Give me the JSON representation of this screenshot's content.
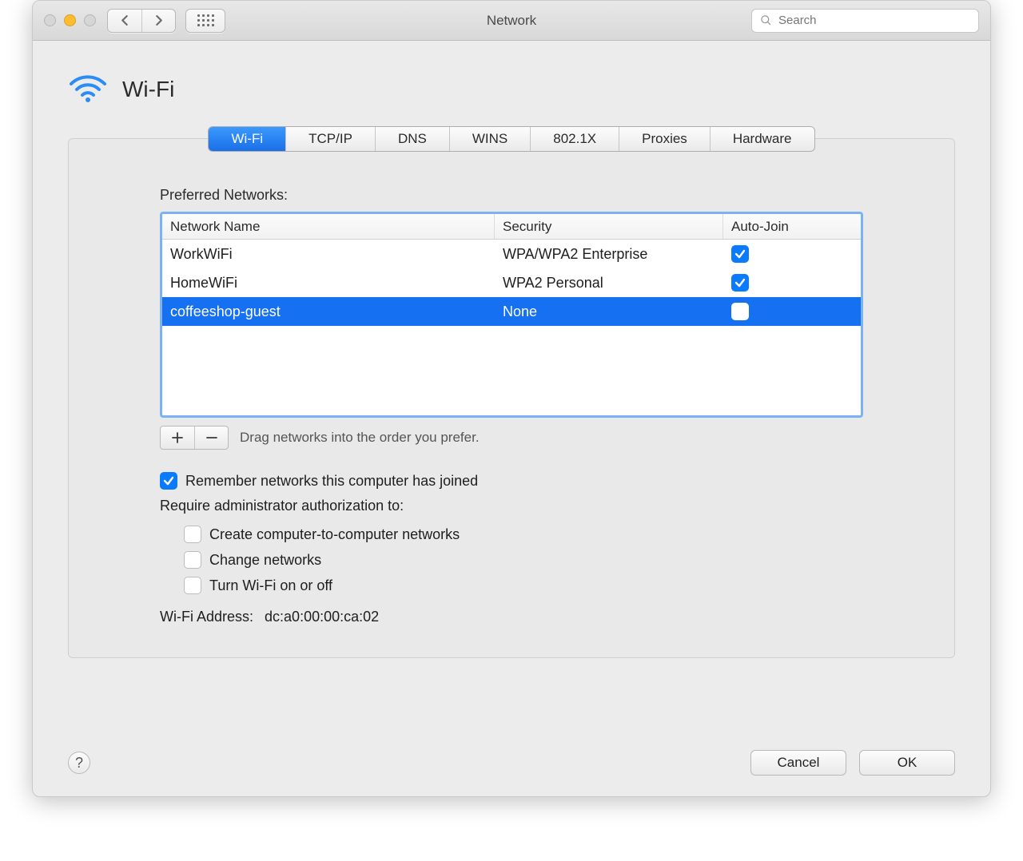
{
  "window": {
    "title": "Network",
    "search_placeholder": "Search"
  },
  "header": {
    "title": "Wi-Fi"
  },
  "tabs": [
    {
      "label": "Wi-Fi",
      "active": true
    },
    {
      "label": "TCP/IP",
      "active": false
    },
    {
      "label": "DNS",
      "active": false
    },
    {
      "label": "WINS",
      "active": false
    },
    {
      "label": "802.1X",
      "active": false
    },
    {
      "label": "Proxies",
      "active": false
    },
    {
      "label": "Hardware",
      "active": false
    }
  ],
  "preferred": {
    "label": "Preferred Networks:",
    "columns": {
      "name": "Network Name",
      "security": "Security",
      "autojoin": "Auto-Join"
    },
    "rows": [
      {
        "name": "WorkWiFi",
        "security": "WPA/WPA2 Enterprise",
        "autojoin": true,
        "selected": false
      },
      {
        "name": "HomeWiFi",
        "security": "WPA2 Personal",
        "autojoin": true,
        "selected": false
      },
      {
        "name": "coffeeshop-guest",
        "security": "None",
        "autojoin": false,
        "selected": true
      }
    ],
    "drag_hint": "Drag networks into the order you prefer."
  },
  "options": {
    "remember": {
      "label": "Remember networks this computer has joined",
      "checked": true
    },
    "require_label": "Require administrator authorization to:",
    "create": {
      "label": "Create computer-to-computer networks",
      "checked": false
    },
    "change": {
      "label": "Change networks",
      "checked": false
    },
    "toggle": {
      "label": "Turn Wi-Fi on or off",
      "checked": false
    }
  },
  "address": {
    "label": "Wi-Fi Address:",
    "value": "dc:a0:00:00:ca:02"
  },
  "footer": {
    "cancel": "Cancel",
    "ok": "OK"
  }
}
